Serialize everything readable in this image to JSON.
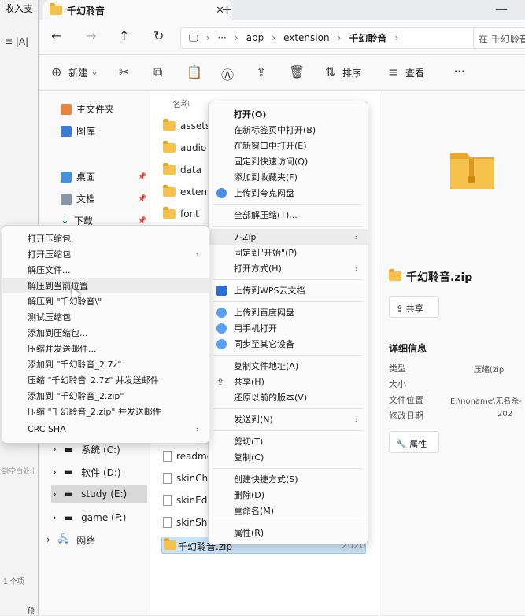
{
  "background_window": {
    "title": "收入支",
    "toolbar": "≡ |A|",
    "hint": "到空白处上",
    "status": "1 个项",
    "preview": "预"
  },
  "tab": {
    "title": "千幻聆音",
    "close": "✕",
    "new": "+"
  },
  "window_controls": {
    "minimize": "—"
  },
  "address": {
    "back": "←",
    "forward": "→",
    "up": "↑",
    "refresh": "↻",
    "pc": "🖵",
    "crumbs": [
      "app",
      "extension",
      "千幻聆音"
    ],
    "search_placeholder": "在 千幻聆音"
  },
  "toolbar": {
    "new": "新建",
    "sort": "排序",
    "view": "查看",
    "more": "···"
  },
  "nav": {
    "items": [
      {
        "label": "主文件夹"
      },
      {
        "label": "图库"
      },
      {
        "label": "桌面"
      },
      {
        "label": "文档"
      },
      {
        "label": "下载"
      }
    ],
    "drives": [
      {
        "label": "系统 (C:)"
      },
      {
        "label": "软件 (D:)"
      },
      {
        "label": "study (E:)"
      },
      {
        "label": "game (F:)"
      }
    ],
    "network": "网络"
  },
  "filelist": {
    "column_name": "名称",
    "folders": [
      "assets",
      "audio",
      "data",
      "extensio",
      "font"
    ],
    "files_bottom": [
      "readme",
      "skinCha",
      "skinEdit",
      "skinSha"
    ],
    "selected": {
      "name": "千幻聆音.zip",
      "year": "2020"
    }
  },
  "details": {
    "title": "千幻聆音.zip",
    "share": "共享",
    "info_heading": "详细信息",
    "rows": [
      {
        "k": "类型",
        "v": "压缩(zip"
      },
      {
        "k": "大小",
        "v": ""
      },
      {
        "k": "文件位置",
        "v": "E:\\noname\\无名杀-"
      },
      {
        "k": "修改日期",
        "v": "202"
      }
    ],
    "properties": "属性"
  },
  "context_menu": {
    "items": [
      {
        "label": "打开(O)",
        "bold": true
      },
      {
        "label": "在新标签页中打开(B)"
      },
      {
        "label": "在新窗口中打开(E)"
      },
      {
        "label": "固定到快速访问(Q)"
      },
      {
        "label": "添加到收藏夹(F)"
      },
      {
        "label": "上传到夸克网盘"
      },
      {
        "label": "全部解压缩(T)..."
      },
      {
        "label": "7-Zip"
      },
      {
        "label": "固定到\"开始\"(P)"
      },
      {
        "label": "打开方式(H)"
      },
      {
        "label": "上传到WPS云文档"
      },
      {
        "label": "上传到百度网盘"
      },
      {
        "label": "用手机打开"
      },
      {
        "label": "同步至其它设备"
      },
      {
        "label": "复制文件地址(A)"
      },
      {
        "label": "共享(H)"
      },
      {
        "label": "还原以前的版本(V)"
      },
      {
        "label": "发送到(N)"
      },
      {
        "label": "剪切(T)"
      },
      {
        "label": "复制(C)"
      },
      {
        "label": "创建快捷方式(S)"
      },
      {
        "label": "删除(D)"
      },
      {
        "label": "重命名(M)"
      },
      {
        "label": "属性(R)"
      }
    ]
  },
  "submenu": {
    "items": [
      {
        "label": "打开压缩包"
      },
      {
        "label": "打开压缩包"
      },
      {
        "label": "解压文件..."
      },
      {
        "label": "解压到当前位置"
      },
      {
        "label": "解压到 \"千幻聆音\\\""
      },
      {
        "label": "测试压缩包"
      },
      {
        "label": "添加到压缩包..."
      },
      {
        "label": "压缩并发送邮件..."
      },
      {
        "label": "添加到 \"千幻聆音_2.7z\""
      },
      {
        "label": "压缩 \"千幻聆音_2.7z\" 并发送邮件"
      },
      {
        "label": "添加到 \"千幻聆音_2.zip\""
      },
      {
        "label": "压缩 \"千幻聆音_2.zip\" 并发送邮件"
      },
      {
        "label": "CRC SHA"
      }
    ]
  },
  "colors": {
    "folder": "#f6c24b",
    "accent": "#0067c0",
    "selection": "#cce4f7"
  }
}
